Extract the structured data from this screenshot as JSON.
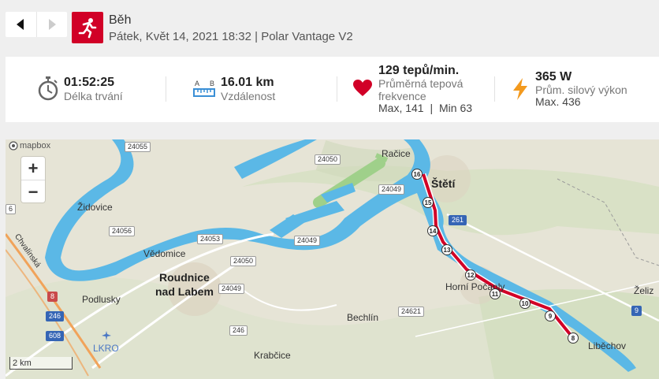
{
  "header": {
    "title": "Běh",
    "subtitle": "Pátek, Květ 14, 2021 18:32 | Polar Vantage V2",
    "accent_color": "#d10027",
    "activity_icon": "running-icon"
  },
  "nav": {
    "back_icon": "chevron-left-icon",
    "forward_icon": "chevron-right-icon"
  },
  "stats": {
    "duration": {
      "value": "01:52:25",
      "label": "Délka trvání",
      "icon": "stopwatch-icon"
    },
    "distance": {
      "value": "16.01 km",
      "label": "Vzdálenost",
      "icon": "ruler-icon",
      "a": "A",
      "b": "B"
    },
    "heart_rate": {
      "value": "129 tepů/min.",
      "label_line1": "Průměrná tepová",
      "label_line2": "frekvence",
      "max": "Max, 141",
      "sep": "|",
      "min": "Min 63",
      "icon": "heart-icon"
    },
    "power": {
      "value": "365 W",
      "label": "Prům. silový výkon",
      "max": "Max. 436",
      "icon": "lightning-icon"
    }
  },
  "map": {
    "attribution": "mapbox",
    "zoom_in": "+",
    "zoom_out": "−",
    "scale": "2 km",
    "places": {
      "racice": "Račice",
      "steti": "Štětí",
      "zidovice": "Židovice",
      "vedomice": "Vědomice",
      "roudnice1": "Roudnice",
      "roudnice2": "nad Labem",
      "podlusky": "Podlusky",
      "bechlin": "Bechlín",
      "horni": "Horní Počaply",
      "krabcice": "Krabčice",
      "libechov": "Liběchov",
      "lkro": "LKRO",
      "chvalinska": "Chvalínská",
      "zeliz": "Želiz"
    },
    "roads": {
      "r24055": "24055",
      "r24050a": "24050",
      "r24049a": "24049",
      "r24056": "24056",
      "r24053": "24053",
      "r24050b": "24050",
      "r24049b": "24049",
      "r24049c": "24049",
      "r261": "261",
      "r24621": "24621",
      "r246a": "246",
      "r246b": "246",
      "r608": "608",
      "r8": "8",
      "r9": "9",
      "r6": "6"
    },
    "km_markers": [
      "16",
      "15",
      "14",
      "13",
      "12",
      "11",
      "10",
      "9",
      "8"
    ],
    "route_color": "#d10027",
    "water_color": "#5bb8e6"
  }
}
